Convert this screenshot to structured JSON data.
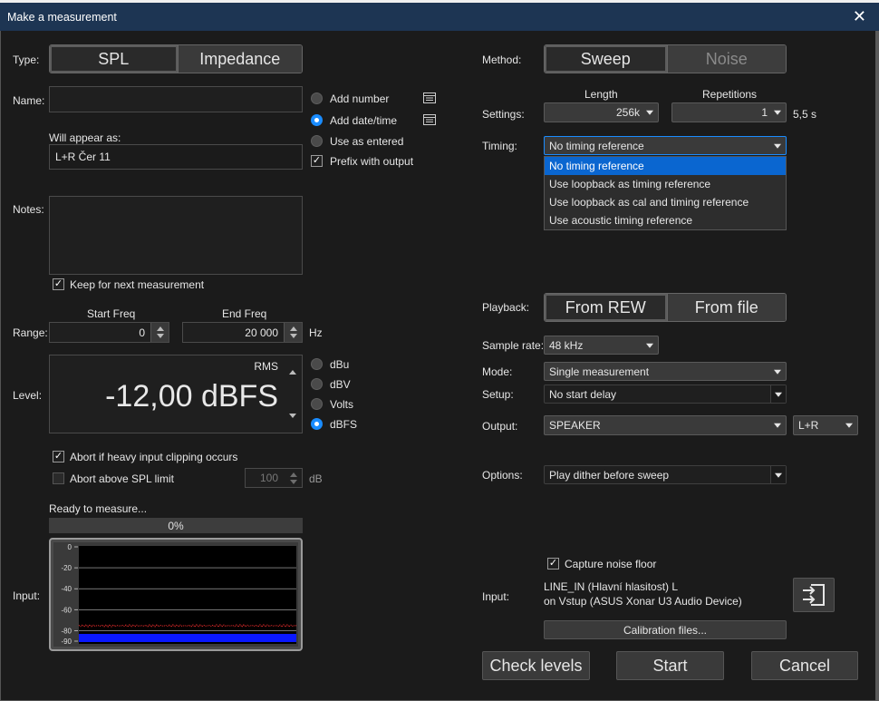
{
  "window": {
    "title": "Make a measurement"
  },
  "left": {
    "type_label": "Type:",
    "type_options": [
      "SPL",
      "Impedance"
    ],
    "name_label": "Name:",
    "name_value": "",
    "name_mode_options": [
      "Add number",
      "Add date/time",
      "Use as entered"
    ],
    "prefix_label": "Prefix with output",
    "will_appear_label": "Will appear as:",
    "will_appear_value": "L+R Čer 11",
    "notes_label": "Notes:",
    "notes_value": "",
    "keep_label": "Keep for next measurement",
    "range_label": "Range:",
    "start_freq_label": "Start Freq",
    "start_freq_value": "0",
    "end_freq_label": "End Freq",
    "end_freq_value": "20 000",
    "hz_label": "Hz",
    "level_label": "Level:",
    "level_rms": "RMS",
    "level_value": "-12,00 dBFS",
    "level_units": [
      "dBu",
      "dBV",
      "Volts",
      "dBFS"
    ],
    "abort_clip_label": "Abort if heavy input clipping occurs",
    "abort_spl_label": "Abort above SPL limit",
    "spl_limit_value": "100",
    "db_label": "dB",
    "ready_text": "Ready to measure...",
    "progress_text": "0%",
    "progress_fraction": 0,
    "input_label": "Input:",
    "meter_ticks": [
      "0",
      "-20",
      "-40",
      "-60",
      "-80",
      "-90"
    ]
  },
  "right": {
    "method_label": "Method:",
    "method_options": [
      "Sweep",
      "Noise"
    ],
    "length_label": "Length",
    "repetitions_label": "Repetitions",
    "settings_label": "Settings:",
    "length_value": "256k",
    "repetitions_value": "1",
    "duration_text": "5,5 s",
    "timing_label": "Timing:",
    "timing_value": "No timing reference",
    "timing_options": [
      "No timing reference",
      "Use loopback as timing reference",
      "Use loopback as cal and timing reference",
      "Use acoustic timing reference"
    ],
    "playback_label": "Playback:",
    "playback_options": [
      "From REW",
      "From file"
    ],
    "sample_rate_label": "Sample rate:",
    "sample_rate_value": "48 kHz",
    "mode_label": "Mode:",
    "mode_value": "Single measurement",
    "setup_label": "Setup:",
    "setup_value": "No start delay",
    "output_label": "Output:",
    "output_value": "SPEAKER",
    "output_channel_value": "L+R",
    "options_label": "Options:",
    "options_value": "Play dither before sweep",
    "capture_noise_label": "Capture noise floor",
    "input_label": "Input:",
    "input_line1": "LINE_IN (Hlavní hlasitost) L",
    "input_line2": "on Vstup (ASUS Xonar U3 Audio Device)",
    "calibration_label": "Calibration files..."
  },
  "buttons": {
    "check_levels": "Check levels",
    "start": "Start",
    "cancel": "Cancel"
  },
  "colors": {
    "accent": "#1a8cff",
    "titlebar": "#1d3553",
    "meter_blue": "#0a18ff",
    "meter_red": "#ff3030"
  }
}
